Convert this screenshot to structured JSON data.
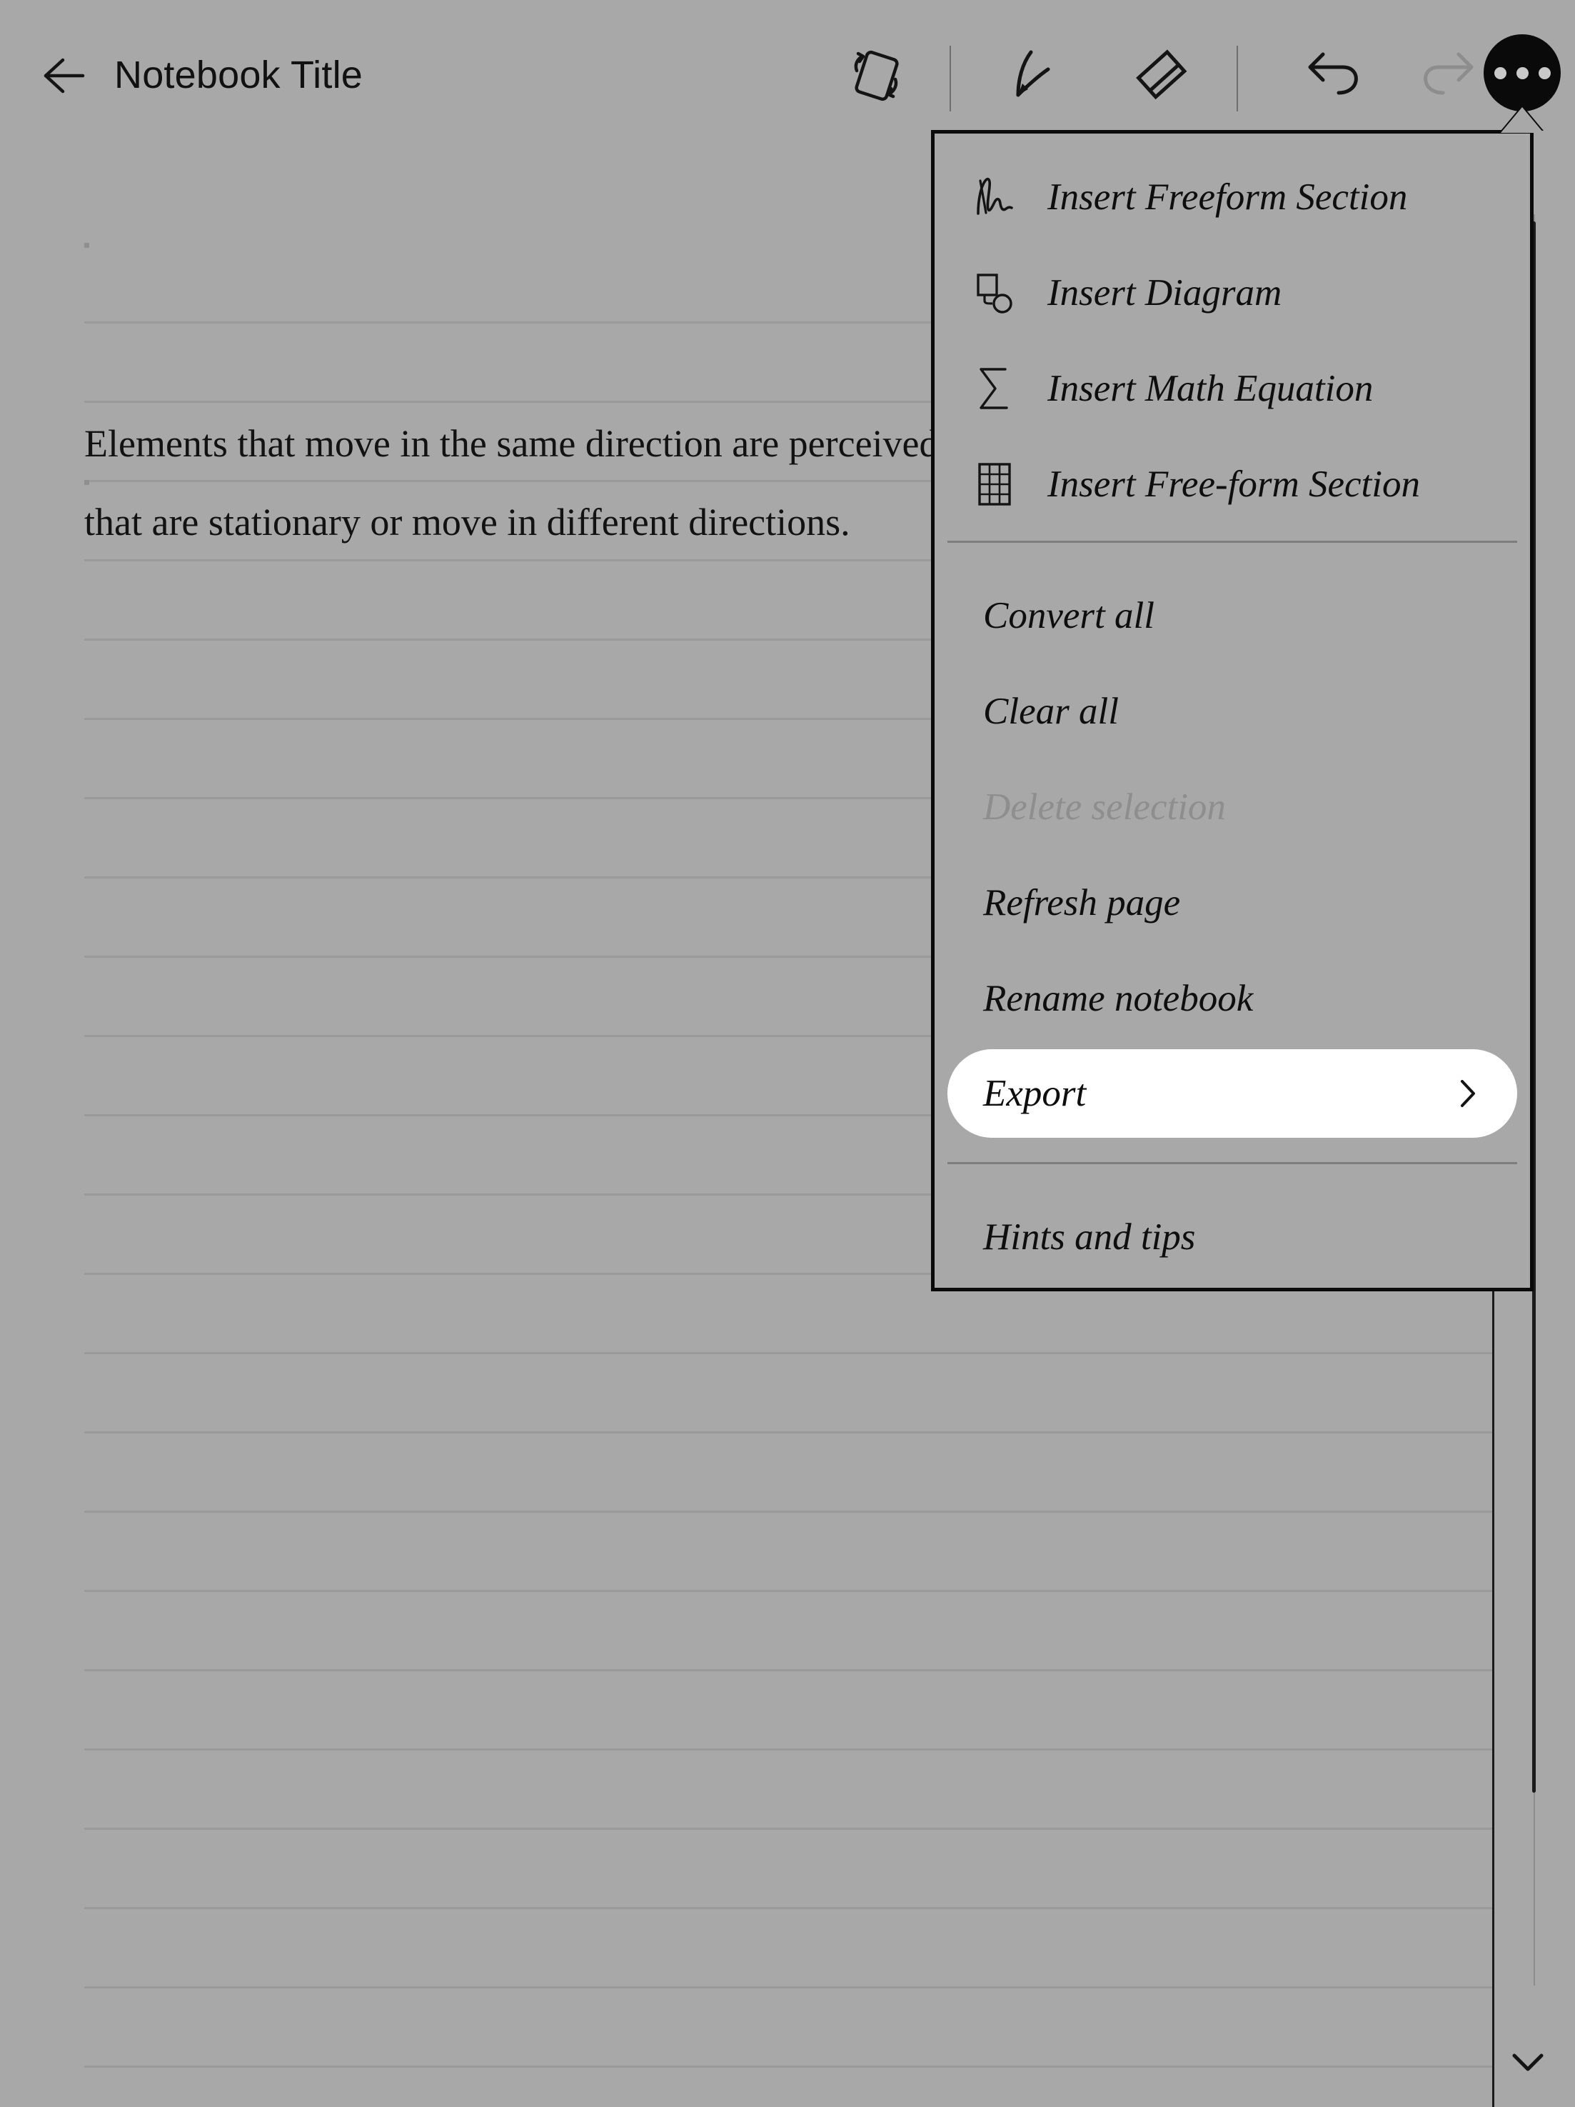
{
  "app": {
    "background_color": "#a8a8a8",
    "accent_color": "#0a0a0a"
  },
  "header": {
    "back_icon": "arrow-left-icon",
    "title": "Notebook Title",
    "tools": [
      {
        "id": "rotate-page",
        "icon": "rotate-page-icon",
        "label": "Rotate page",
        "enabled": true
      },
      {
        "id": "pen",
        "icon": "pen-icon",
        "label": "Pen",
        "enabled": true
      },
      {
        "id": "eraser",
        "icon": "eraser-icon",
        "label": "Eraser",
        "enabled": true
      },
      {
        "id": "undo",
        "icon": "undo-icon",
        "label": "Undo",
        "enabled": true
      },
      {
        "id": "redo",
        "icon": "redo-icon",
        "label": "Redo",
        "enabled": false
      },
      {
        "id": "more",
        "icon": "more-dots-icon",
        "label": "More options",
        "enabled": true
      }
    ]
  },
  "page": {
    "note_lines": [
      "Elements that move in the same direction are perceived as a group, separate from elements",
      "that are stationary or move in different directions."
    ],
    "rule_line_color": "#9a9a9a",
    "scroll_down_icon": "chevron-down-icon"
  },
  "menu": {
    "groups": [
      {
        "items": [
          {
            "label": "Insert Freeform Section",
            "icon": "scribble-icon",
            "disabled": false,
            "highlighted": false,
            "has_submenu": false
          },
          {
            "label": "Insert Diagram",
            "icon": "diagram-icon",
            "disabled": false,
            "highlighted": false,
            "has_submenu": false
          },
          {
            "label": "Insert Math Equation",
            "icon": "sigma-icon",
            "disabled": false,
            "highlighted": false,
            "has_submenu": false
          },
          {
            "label": "Insert Free-form Section",
            "icon": "table-grid-icon",
            "disabled": false,
            "highlighted": false,
            "has_submenu": false
          }
        ]
      },
      {
        "items": [
          {
            "label": "Convert all",
            "icon": null,
            "disabled": false,
            "highlighted": false,
            "has_submenu": false
          },
          {
            "label": "Clear all",
            "icon": null,
            "disabled": false,
            "highlighted": false,
            "has_submenu": false
          },
          {
            "label": "Delete selection",
            "icon": null,
            "disabled": true,
            "highlighted": false,
            "has_submenu": false
          },
          {
            "label": "Refresh page",
            "icon": null,
            "disabled": false,
            "highlighted": false,
            "has_submenu": false
          },
          {
            "label": "Rename notebook",
            "icon": null,
            "disabled": false,
            "highlighted": false,
            "has_submenu": false
          },
          {
            "label": "Export",
            "icon": null,
            "disabled": false,
            "highlighted": true,
            "has_submenu": true,
            "submenu_icon": "chevron-right-icon"
          }
        ]
      },
      {
        "items": [
          {
            "label": "Hints and tips",
            "icon": null,
            "disabled": false,
            "highlighted": false,
            "has_submenu": false
          }
        ]
      }
    ],
    "items_flat": [
      "Insert Freeform Section",
      "Insert Diagram",
      "Insert Math Equation",
      "Insert Free-form Section",
      "Convert all",
      "Clear all",
      "Delete selection",
      "Refresh page",
      "Rename notebook",
      "Export",
      "Hints and tips"
    ]
  }
}
